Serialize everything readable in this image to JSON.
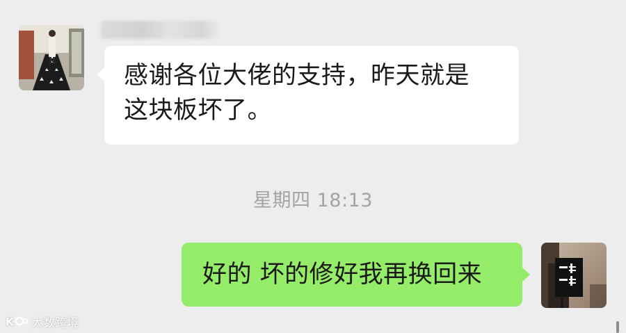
{
  "chat": {
    "messages": [
      {
        "side": "left",
        "lines": [
          "感谢各位大佬的支持，昨天就是",
          "这块板坏了。"
        ]
      },
      {
        "side": "right",
        "text": "好的 坏的修好我再换回来"
      }
    ],
    "timestamp": "星期四 18:13"
  },
  "watermark": {
    "text": "大数跨境",
    "logo_icon": "kr-logo-icon"
  },
  "colors": {
    "background": "#ededed",
    "incoming_bubble": "#ffffff",
    "outgoing_bubble": "#95ec69",
    "timestamp_text": "#a3a3a3",
    "message_text": "#1a1a1a"
  }
}
